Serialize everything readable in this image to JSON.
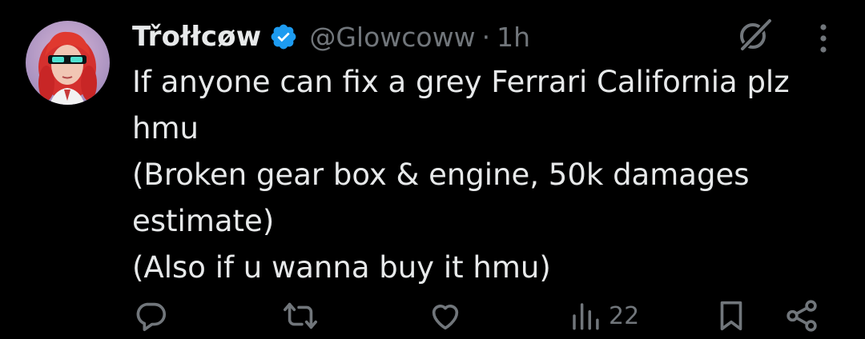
{
  "author": {
    "display_name": "Třołłcøw",
    "handle": "@Glowcoww",
    "separator": "·",
    "time": "1h",
    "verified_icon": "verified-badge-icon",
    "verified_color": "#1d9bf0"
  },
  "post": {
    "lines": [
      "If anyone can fix a grey Ferrari California plz",
      "hmu",
      "(Broken gear box & engine, 50k damages",
      "estimate)",
      "(Also if u wanna buy it hmu)"
    ]
  },
  "actions": {
    "reply_icon": "reply-icon",
    "repost_icon": "repost-icon",
    "like_icon": "like-icon",
    "views_icon": "views-icon",
    "views_count": "22",
    "bookmark_icon": "bookmark-icon",
    "share_icon": "share-icon"
  },
  "top_right": {
    "grok_icon": "grok-icon",
    "more_icon": "more-vertical-icon"
  },
  "colors": {
    "background": "#000000",
    "text_primary": "#e7e9ea",
    "text_secondary": "#71767b",
    "accent": "#1d9bf0"
  }
}
